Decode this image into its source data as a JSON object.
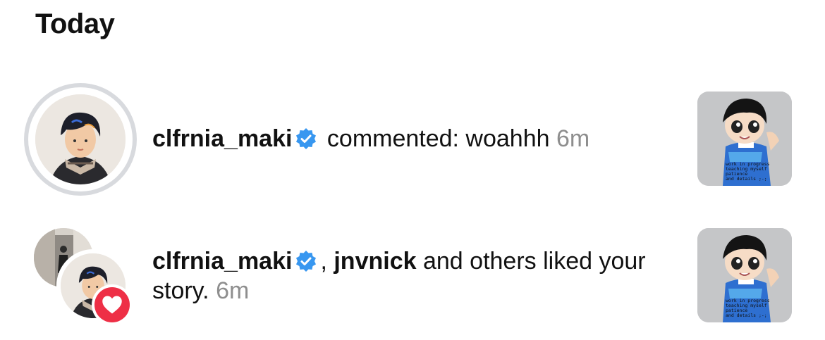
{
  "section": {
    "title": "Today"
  },
  "notifications": [
    {
      "username": "clfrnia_maki",
      "action": "commented: woahhh",
      "time": "6m",
      "icons": {
        "verified": "verified-badge-icon"
      },
      "thumbnail_caption": [
        "work in progress",
        "teaching myself patience",
        "and details ;-;"
      ]
    },
    {
      "username": "clfrnia_maki",
      "separator": ",",
      "second_username": "jnvnick",
      "action": "and others liked your story.",
      "time": "6m",
      "icons": {
        "verified": "verified-badge-icon",
        "badge": "heart-icon"
      },
      "thumbnail_caption": [
        "work in progress",
        "teaching myself patience",
        "and details ;-;"
      ]
    }
  ],
  "colors": {
    "verified_blue": "#3897f0",
    "heart_red": "#ee2f46",
    "time_gray": "#8e8e8e",
    "ring_gray": "#d8dade"
  }
}
